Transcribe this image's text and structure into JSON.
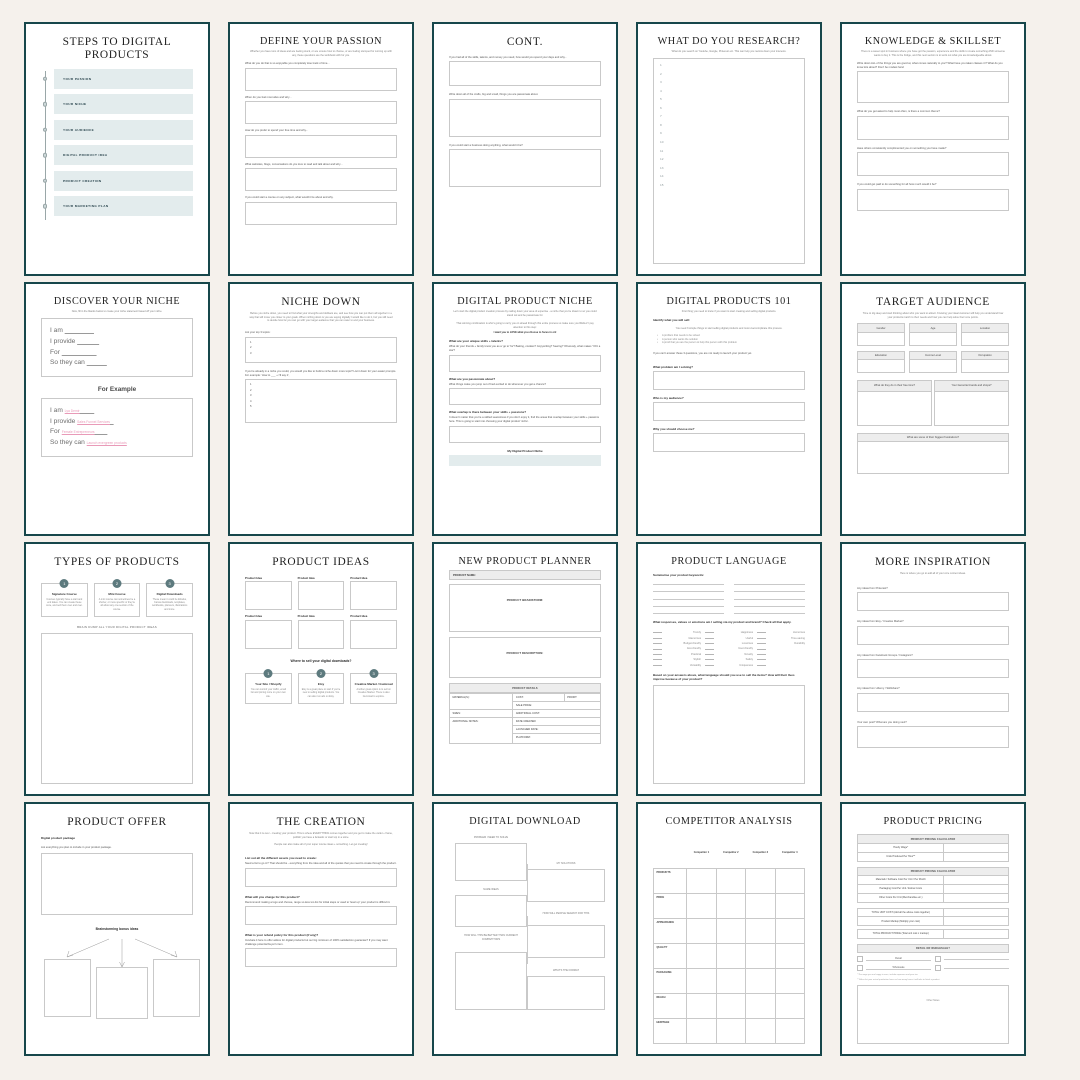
{
  "palette": {
    "background": "#f5f1ec",
    "border": "#17474b",
    "accent_fill": "#e3eced",
    "pink": "#e99ab8",
    "grey_fill": "#ededed"
  },
  "pages": [
    {
      "id": "steps-to-digital-products",
      "title": "STEPS TO DIGITAL\nPRODUCTS",
      "steps": [
        "YOUR PASSION",
        "YOUR NICHE",
        "YOUR AUDIENCE",
        "DIGITAL PRODUCT IDEA",
        "PRODUCT CREATION",
        "YOUR MARKETING PLAN"
      ]
    },
    {
      "id": "define-your-passion",
      "title": "DEFINE YOUR PASSION",
      "subtitle": "Whether you have tons of ideas and are feeling stuck, or are unsure how to choose, or are feeling stumped for coming up with any, these questions are the workbook with for you.",
      "questions": [
        "What do you do that is so enjoyable you completely lose track of time...",
        "When do you feel most alive and why...",
        "How do you prefer to spend your free time and why...",
        "What websites, blogs, conversations do you love to read and talk about and why...",
        "If you could start a course on any subject, what would it be about and why."
      ]
    },
    {
      "id": "cont",
      "title": "CONT.",
      "questions": [
        "If you had all of the skills, talents, and money you need, how would you spend your days and why...",
        "Write down all of the crafts, big and small, things you are passionate about.",
        "If you could start a business doing anything, what would it be?"
      ]
    },
    {
      "id": "what-do-you-research",
      "title": "WHAT DO YOU RESEARCH?",
      "subtitle": "What do you search on Youtube, Google, Pinterest etc. This can help you narrow down your interests.",
      "numbers": [
        "1",
        "2",
        "3",
        "4",
        "5",
        "6",
        "7",
        "8",
        "9",
        "10",
        "11",
        "12",
        "13",
        "14",
        "15"
      ]
    },
    {
      "id": "knowledge-skillset",
      "title": "KNOWLEDGE & SKILLSET",
      "subtitle": "There is a sweet spot in business where you have got the passion, experience and the skills to create something AND someone wants to buy it. This is the bridge, and this next section is to work out what you are knowledgeable about.",
      "questions": [
        "Write down ALL of the things you are good at, what comes naturally to you? What have you taken classes in? What do you know lots about? Don't be modest here!",
        "What do you get asked to help most often, is there a common theme?",
        "Have others consistently complimented you on something you have made?",
        "If you could get paid to do something for all how much would it be?"
      ]
    },
    {
      "id": "discover-your-niche",
      "title": "DISCOVER YOUR NICHE",
      "subtitle": "Now, fill in the blanks below to create your niche statement based off your niche.",
      "statement_lines": [
        "I am",
        "I provide",
        "For",
        "So they can"
      ],
      "example_heading": "For Example",
      "example_values": [
        "Lya Demir",
        "Sales Funnel Services",
        "Female Entrepreneurs",
        "Launch evergreen products"
      ]
    },
    {
      "id": "niche-down",
      "title": "NICHE DOWN",
      "subtitle": "Before you niche down, you need to find what your strengths and skillsets are, and see how you can put them all together in a way that will move you closer to your goals. When niching down is you are saying digitally I would like to do it, but you still need to decide how far you can go with your target audience that you can cater to and your business.",
      "prompt1": "List your top 3 topics:",
      "list1": [
        "1",
        "2",
        "3"
      ],
      "prompt2": "If you're already in a niche you could, you would you like to build a niche down more topic? List it down for your easier prompts. For example: 'How to ___ + I'll say it',",
      "list2": [
        "1",
        "2",
        "3",
        "4",
        "5"
      ]
    },
    {
      "id": "digital-product-niche",
      "title": "DIGITAL PRODUCT NICHE",
      "subtitle": "Let's start the digital product creation process by nailing down your area of expertise - a niche that you're drawn to so you could stand out and be passionate for.",
      "subtitle2": "That winning combination is who's going to carry you on ahead through this entire process so make sure you REALLY pay attention to this step:",
      "emphasis": "I want you to LOVE what you choose to focus in on!",
      "sections": [
        {
          "heading": "What are your unique skills + talents?",
          "hint": "What do your friends + family know you as a 'go to' for? Baking, cookies? Copywriting? Sewing? Obviously, what makes YOU a star?"
        },
        {
          "heading": "What are you passionate about?",
          "hint": "What things make you jump out of bed excited to do whenever you get a chance?"
        },
        {
          "heading": "What overlap is there between your skills + passions?",
          "hint": "It doesn't matter that you're a skilled seamstress if you don't enjoy it, find the areas that overlap between your skills + passions here. This is going to start into choosing your digital product 'niche'."
        }
      ],
      "footer": "My Digital Product Niche"
    },
    {
      "id": "digital-products-101",
      "title": "DIGITAL PRODUCTS 101",
      "subtitle": "First thing you need to know if you want to start creating and selling digital products.",
      "heading": "Identify what you will sell:",
      "hint": "You need 3 simple things to start selling digital products and most overcomplicate this process.",
      "bullets": [
        "A problem that needs to be solved",
        "A person who wants the solution",
        "A proof that you are the person to help this person with this problem"
      ],
      "note": "If you can't answer these 3 questions, you are not ready to launch your product yet.",
      "questions": [
        "What problem am I solving?",
        "Who is my audience?",
        "Why you should choose me?"
      ]
    },
    {
      "id": "target-audience",
      "title": "TARGET AUDIENCE",
      "subtitle": "Time to dig deep and start thinking about who you want to attract. Knowing your ideal customer will help you understand how your products match to their needs and how you can help solve their core points.",
      "fields": [
        "Gender",
        "Age",
        "Location",
        "Education",
        "Income Level",
        "Occupation"
      ],
      "wide_fields": [
        "What do they do in their free time?",
        "Your favourite brands and shops?"
      ],
      "full_field": "What are some of their biggest frustrations?"
    },
    {
      "id": "types-of-products",
      "title": "TYPES OF PRODUCTS",
      "types": [
        {
          "num": "1",
          "name": "Signature Course",
          "desc": "Courses typically have a start and end dates. You can create these once, and sell them over and over."
        },
        {
          "num": "2",
          "name": "Mini Course",
          "desc": "A mini course can sometimes be a shorter, or more specific or they're all about any one section of the course."
        },
        {
          "num": "3",
          "name": "Digital Downloads",
          "desc": "These mean it could be Ebooks, Canva downloads, templates, workbooks, planners, illustrations and more."
        }
      ],
      "brain_dump": "BRAIN DUMP ALL YOUR DIGITAL PRODUCT IDEAS"
    },
    {
      "id": "product-ideas",
      "title": "PRODUCT IDEAS",
      "idea_label": "Product Idea",
      "idea_count": 6,
      "sell_heading": "Where to sell your digital downloads?",
      "channels": [
        {
          "num": "1",
          "name": "Your Site / Shopify",
          "desc": "You can control your traffic, email list and pricing more on your own site."
        },
        {
          "num": "2",
          "name": "Etsy",
          "desc": "Etsy is a great place to start if you're new to selling digital products. You can also run ads on Etsy."
        },
        {
          "num": "3",
          "name": "Creative Market / Gumroad",
          "desc": "Another great option is to sell on Creative Market. There is also Gumroad to explore."
        }
      ]
    },
    {
      "id": "new-product-planner",
      "title": "NEW PRODUCT PLANNER",
      "product_name_label": "PRODUCT NAME:",
      "brainstorm_label": "PRODUCT BRAINSTORM:",
      "description_label": "PRODUCT DESCRIPTION:",
      "details_label": "PRODUCT DETAILS",
      "details_rows": [
        {
          "left": "MATERIAL(S):",
          "right": [
            "COST:",
            "PROFIT:"
          ]
        },
        {
          "left": "",
          "right": [
            "SALE PRICE:"
          ]
        },
        {
          "left": "SIZES:",
          "right": [
            "ADDITIONAL COST:"
          ]
        },
        {
          "left": "ADDITIONAL NOTES:",
          "right": [
            "DATE CREATED:"
          ]
        },
        {
          "left": "",
          "right": [
            "LAUNCHED DATE:"
          ]
        },
        {
          "left": "",
          "right": [
            "PLATFORM:"
          ]
        }
      ]
    },
    {
      "id": "product-language",
      "title": "PRODUCT LANGUAGE",
      "keywords_heading": "Summarise your product keywords:",
      "keyword_rows": 5,
      "check_heading": "What responses, values or emotions am I selling via my product and brand? Check all that apply.",
      "check_col1": [
        "Trendy",
        "Glamorous",
        "Budget-friendly",
        "Eco-friendly",
        "Practical",
        "Stylish",
        "Versatility"
      ],
      "check_col2": [
        "Happiness",
        "Useful",
        "Luxurious",
        "User-friendly",
        "Novelty",
        "Safety",
        "Uniqueness"
      ],
      "check_col3": [
        "Humorous",
        "Time-saving",
        "Durability",
        "",
        "",
        "",
        ""
      ],
      "final_question": "Based on your answers above, what language should you use to sell the items? How will their lives improve because of your product?"
    },
    {
      "id": "more-inspiration",
      "title": "MORE INSPIRATION",
      "subtitle": "Here is where you go to add all of your core content ideas.",
      "questions": [
        "Any ideas from Pinterest?",
        "Any ideas from Etsy / Creative Market?",
        "Any ideas from Facebook Groups / Instagram?",
        "Any ideas from Udemy / Skillshare?",
        "Your own post? What are you doing next?"
      ]
    },
    {
      "id": "product-offer",
      "title": "PRODUCT OFFER",
      "heading": "Digital product package",
      "hint": "List everything you plan to include in your product package.",
      "bonus_heading": "Brainstorming bonus ideas"
    },
    {
      "id": "the-creation",
      "title": "THE CREATION",
      "subtitle": "Now that it is over - creating your product. This is where EVERYTHING comes together and you get to make the outlet + frame, publish you have a fantastic or start top in a store.",
      "subtitle2": "People can also make all of your super course ideas + something. Let get creating!",
      "questions": [
        {
          "heading": "List out all the different assets you need to create:",
          "hint": "Need a list to go in? That should be - everything from the idea and all of the quotes that you need to create through the product."
        },
        {
          "heading": "What will you charge for this product?",
          "hint": "Recommend making a logo and choose, range so less too list for initial steps or used to 'level up' your product is difficult it."
        },
        {
          "heading": "What is your refund policy for this product (if any)?",
          "hint": "Incubate it here to offer advice for digital products but our big minimum of 100% satisfaction guarantee? If you may want challenge potential buyer's item."
        }
      ]
    },
    {
      "id": "digital-download",
      "title": "DIGITAL DOWNLOAD",
      "boxes": [
        "PROBLEM I NEED TO SOLVE",
        "MY SOLUTIONS",
        "NAME IDEAS",
        "HOW WILL PEOPLE SEARCH FOR THIS",
        "HOW WILL THIS BE BETTER THAN CURRENT COMPETITORS",
        "WHAT'S THE FORMAT"
      ]
    },
    {
      "id": "competitor-analysis",
      "title": "COMPETITOR ANALYSIS",
      "columns": [
        "Competitor 1",
        "Competitor 2",
        "Competitor 3",
        "Competitor 4"
      ],
      "rows": [
        "PRODUCTS",
        "PRICE",
        "APPEARANCE",
        "QUALITY",
        "PACKAGING",
        "REACH",
        "HERITAGE"
      ]
    },
    {
      "id": "product-pricing",
      "title": "PRODUCT PRICING",
      "section1_header": "PRODUCT PRICING CALCULATOR",
      "section1_rows": [
        "Hourly Wage*",
        "Units Produced Per Hour**"
      ],
      "section2_header": "PRODUCT PRICING CALCULATOR",
      "section2_rows": [
        "Materials / Software Cost Per Unit / Per Month",
        "Packaging Cost Per Unit / Extras Costs",
        "Other Costs Per Unit (Merchandise etc.)"
      ],
      "section3_rows": [
        "TOTAL UNIT COST (Add all the above costs together)",
        "Product Markup (Multiply your cost)",
        "TOTAL PRODUCT PRICE (Total unit cost x markup)"
      ],
      "section4_header": "RETAIL OR WHOLESALE?",
      "section4_options": [
        "Retail",
        "Wholesale"
      ],
      "notes": [
        "* The wage you are happy to earn, include expenses and your tax.",
        "** Either list your actual production hours or how many hours it will take to finish a product."
      ],
      "final_label": "Other Notes"
    }
  ]
}
